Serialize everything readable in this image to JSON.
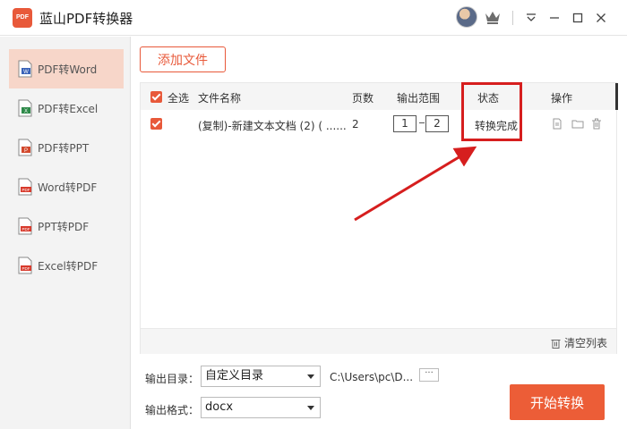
{
  "window": {
    "logo_text": "PDF",
    "title": "蓝山PDF转换器"
  },
  "sidebar": {
    "items": [
      {
        "label": "PDF转Word",
        "icon": "word-doc-icon",
        "active": true
      },
      {
        "label": "PDF转Excel",
        "icon": "excel-doc-icon",
        "active": false
      },
      {
        "label": "PDF转PPT",
        "icon": "ppt-doc-icon",
        "active": false
      },
      {
        "label": "Word转PDF",
        "icon": "pdf-doc-icon",
        "active": false
      },
      {
        "label": "PPT转PDF",
        "icon": "pdf-doc-icon",
        "active": false
      },
      {
        "label": "Excel转PDF",
        "icon": "pdf-doc-icon",
        "active": false
      }
    ]
  },
  "toolbar": {
    "add_file_label": "添加文件"
  },
  "table": {
    "headers": {
      "select_all": "全选",
      "filename": "文件名称",
      "pages": "页数",
      "range": "输出范围",
      "status": "状态",
      "actions": "操作"
    },
    "rows": [
      {
        "filename": "(复制)-新建文本文档 (2) ( ......",
        "pages": "2",
        "range_start": "1",
        "range_end": "2",
        "status": "转换完成"
      }
    ],
    "clear_label": "清空列表"
  },
  "output": {
    "dir_label": "输出目录：",
    "dir_value": "自定义目录",
    "path": "C:\\Users\\pc\\D...",
    "more_label": "···",
    "format_label": "输出格式：",
    "format_value": "docx",
    "start_label": "开始转换"
  },
  "colors": {
    "accent": "#e8593a",
    "annotation": "#d61e1e"
  }
}
